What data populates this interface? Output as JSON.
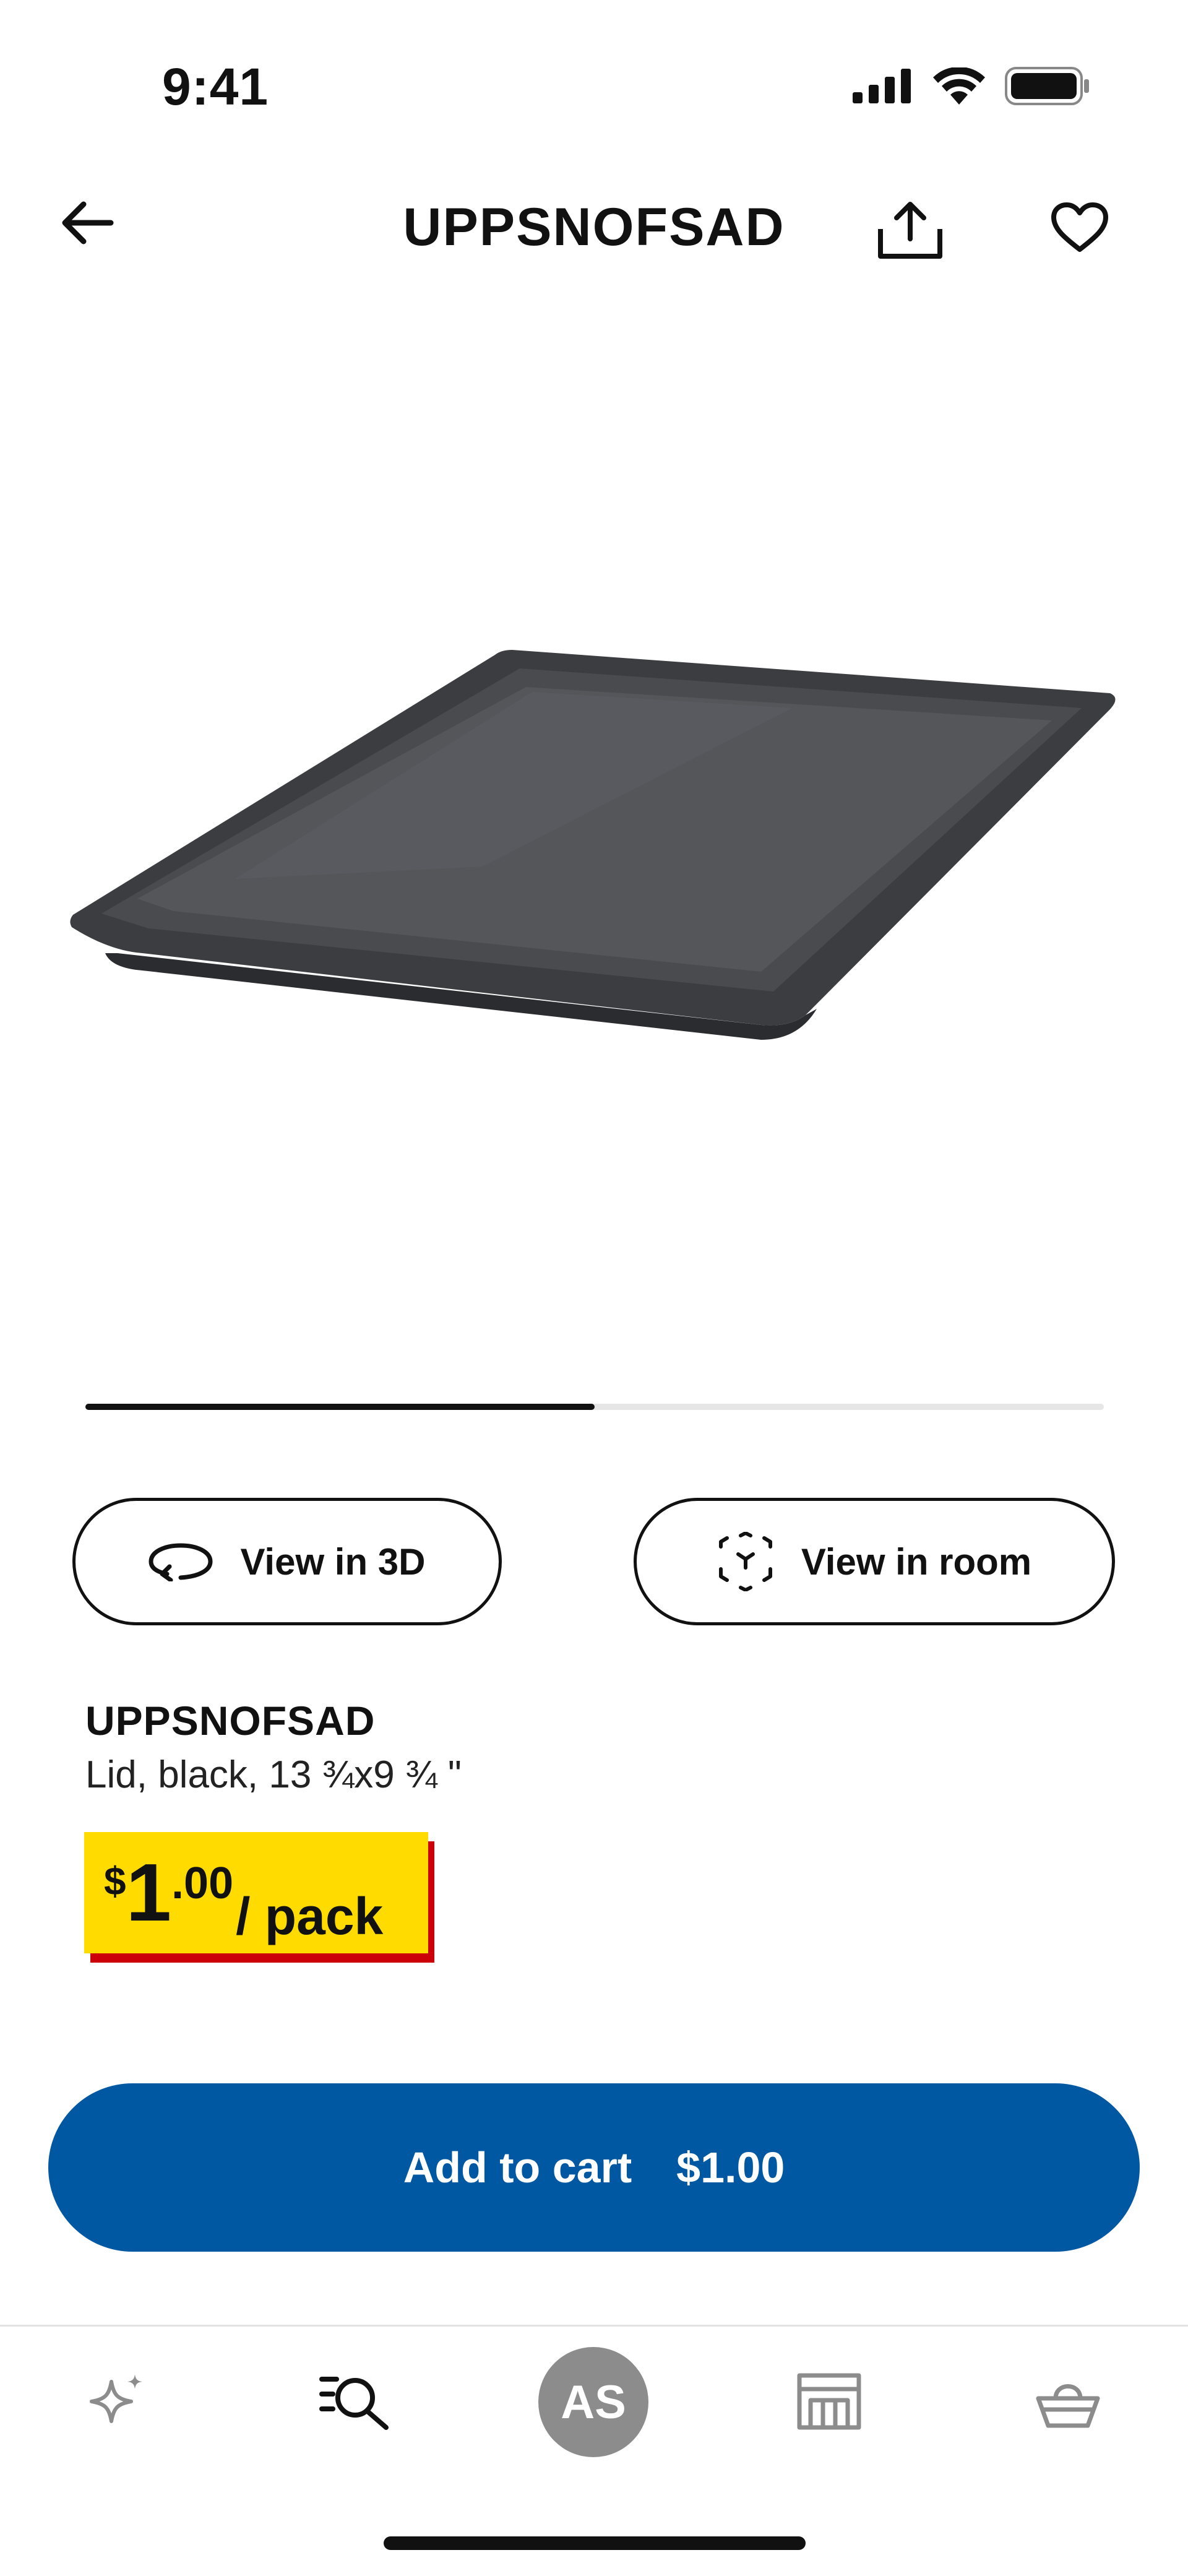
{
  "status_bar": {
    "time": "9:41"
  },
  "header": {
    "title": "UPPSNOFSAD"
  },
  "carousel": {
    "progress": 0.5
  },
  "actions": {
    "view_3d_label": "View in 3D",
    "view_room_label": "View in room"
  },
  "product": {
    "name": "UPPSNOFSAD",
    "description": "Lid, black, 13 ¾x9 ¾ \""
  },
  "price": {
    "currency": "$",
    "integer": "1",
    "decimal": ".00",
    "unit": "/ pack"
  },
  "cart": {
    "label": "Add to cart",
    "price": "$1.00"
  },
  "bottom_nav": {
    "items": [
      "sparkle-icon",
      "search-list-icon",
      "avatar",
      "store-icon",
      "basket-icon"
    ],
    "avatar_initials": "AS"
  },
  "colors": {
    "primary": "#0058a3",
    "price_tag": "#ffdb00",
    "price_tag_shadow": "#cc0008",
    "avatar": "#8c8c8c"
  }
}
